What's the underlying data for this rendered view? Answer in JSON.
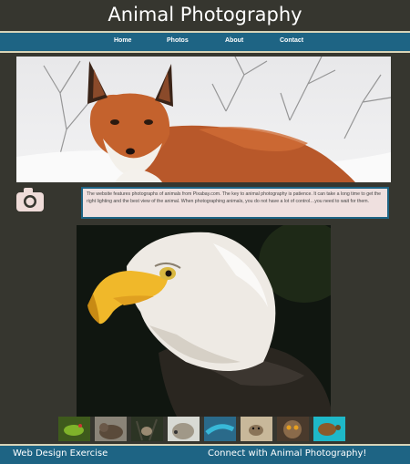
{
  "header": {
    "title": "Animal Photography"
  },
  "nav": {
    "items": [
      {
        "label": "Home"
      },
      {
        "label": "Photos"
      },
      {
        "label": "About"
      },
      {
        "label": "Contact"
      }
    ]
  },
  "hero": {
    "image_alt": "Red fox"
  },
  "about": {
    "icon": "camera-icon",
    "text": "The website features photographs of animals from Pixabay.com. The key to animal photography is patience. It can take a long time to get the right lighting and the best view of the animal. When photographing animals, you do not have a lot of control…you need to wait for them."
  },
  "feature": {
    "image_alt": "Bald eagle"
  },
  "thumbnails": [
    {
      "name": "frog"
    },
    {
      "name": "bear"
    },
    {
      "name": "deer"
    },
    {
      "name": "hedgehog"
    },
    {
      "name": "lizard"
    },
    {
      "name": "otter"
    },
    {
      "name": "owl"
    },
    {
      "name": "turtle"
    }
  ],
  "footer": {
    "left": "Web Design Exercise",
    "right": "Connect with Animal Photography!"
  },
  "colors": {
    "background": "#36362f",
    "nav": "#1e6484",
    "about_box": "#efe0df",
    "accent_line": "#d8d4b8"
  }
}
